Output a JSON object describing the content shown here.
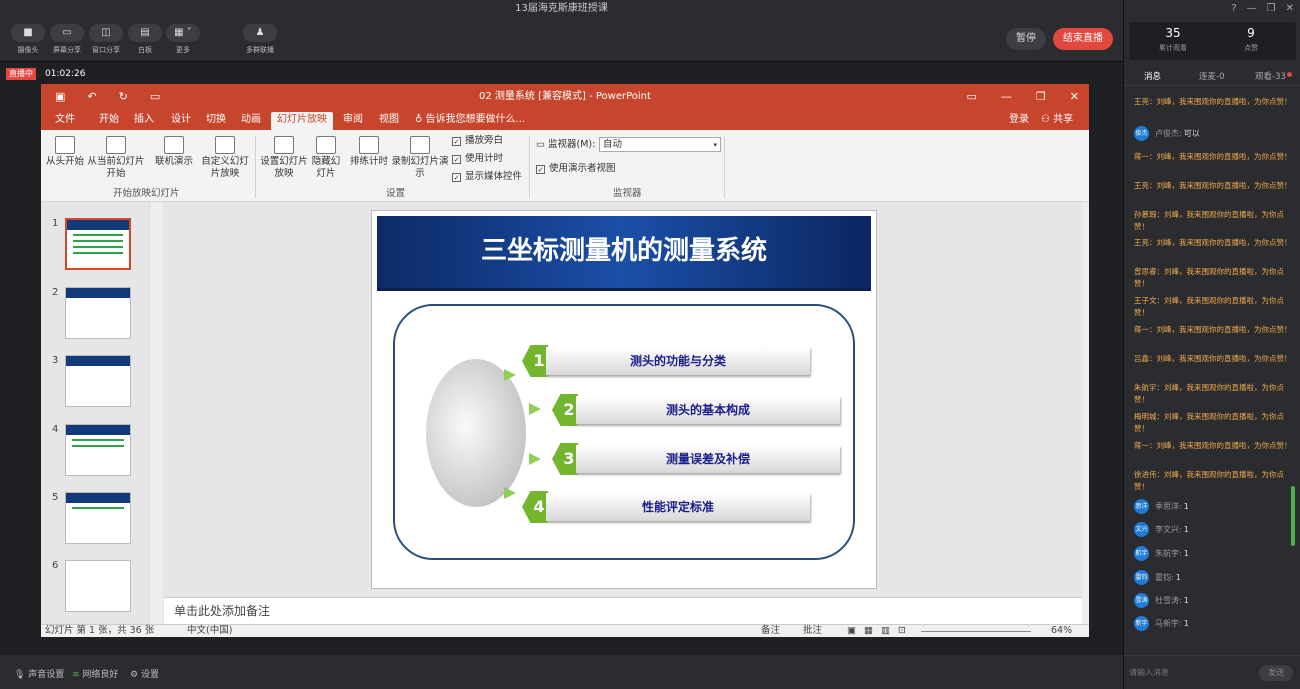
{
  "window": {
    "title": "13届海克斯康班授课"
  },
  "toolbar": {
    "buttons": [
      {
        "label": "摄像头",
        "icon": "camera-icon"
      },
      {
        "label": "屏幕分享",
        "icon": "screen-share-icon"
      },
      {
        "label": "窗口分享",
        "icon": "window-share-icon"
      },
      {
        "label": "白板",
        "icon": "whiteboard-icon"
      },
      {
        "label": "更多",
        "icon": "grid-icon"
      },
      {
        "label": "多群联播",
        "icon": "multi-group-icon"
      }
    ],
    "pause": "暂停",
    "end": "结束直播"
  },
  "live": {
    "status": "直播中",
    "time": "01:02:26"
  },
  "ppt": {
    "title": "02 测量系统 [兼容模式] - PowerPoint",
    "tabs": [
      "文件",
      "开始",
      "插入",
      "设计",
      "切换",
      "动画",
      "幻灯片放映",
      "审阅",
      "视图"
    ],
    "tell_me": "告诉我您想要做什么...",
    "login": "登录",
    "share": "共享",
    "ribbon": {
      "from_beginning": "从头开始",
      "from_current": "从当前幻灯片开始",
      "online": "联机演示",
      "custom": "自定义幻灯片放映",
      "group1": "开始放映幻灯片",
      "setup": "设置幻灯片放映",
      "hide": "隐藏幻灯片",
      "rehearse": "排练计时",
      "record": "录制幻灯片演示",
      "play_narration": "播放旁白",
      "use_timings": "使用计时",
      "show_media": "显示媒体控件",
      "group2": "设置",
      "monitor_label": "监视器(M):",
      "monitor_value": "自动",
      "presenter_view": "使用演示者视图",
      "group3": "监视器"
    },
    "thumb_numbers": [
      "1",
      "2",
      "3",
      "4",
      "5",
      "6"
    ],
    "slide": {
      "title": "三坐标测量机的测量系统",
      "items": [
        {
          "num": "1",
          "text": "测头的功能与分类"
        },
        {
          "num": "2",
          "text": "测头的基本构成"
        },
        {
          "num": "3",
          "text": "测量误差及补偿"
        },
        {
          "num": "4",
          "text": "性能评定标准"
        }
      ]
    },
    "notes": "单击此处添加备注",
    "status": {
      "slide": "幻灯片 第 1 张，共 36 张",
      "lang": "中文(中国)",
      "notes": "备注",
      "comments": "批注",
      "zoom": "64%"
    }
  },
  "bottom": {
    "sound": "声音设置",
    "network": "网络良好",
    "settings": "设置"
  },
  "sidebar": {
    "stats": [
      {
        "value": "35",
        "label": "累计观看"
      },
      {
        "value": "9",
        "label": "点赞"
      }
    ],
    "tabs": [
      "消息",
      "连麦-0",
      "观看-33"
    ],
    "messages": [
      {
        "text": "王亮：刘峰，我来围观你的直播啦，为你点赞！"
      },
      {
        "text": "蒋一：刘峰，我来围观你的直播啦，为你点赞！"
      },
      {
        "text": "王亮：刘峰，我来围观你的直播啦，为你点赞！"
      },
      {
        "text": "孙慕瑕：刘峰，我来围观你的直播啦，为你点赞！"
      },
      {
        "text": "王亮：刘峰，我来围观你的直播啦，为你点赞！"
      },
      {
        "text": "曾思睿：刘峰，我来围观你的直播啦，为你点赞！"
      },
      {
        "text": "王子文：刘峰，我来围观你的直播啦，为你点赞！"
      },
      {
        "text": "蒋一：刘峰，我来围观你的直播啦，为你点赞！"
      },
      {
        "text": "吕鑫：刘峰，我来围观你的直播啦，为你点赞！"
      },
      {
        "text": "朱航宇：刘峰，我来围观你的直播啦，为你点赞！"
      },
      {
        "text": "梅明城：刘峰，我来围观你的直播啦，为你点赞！"
      },
      {
        "text": "蒋一：刘峰，我来围观你的直播啦，为你点赞！"
      },
      {
        "text": "徐进伟：刘峰，我来围观你的直播啦，为你点赞！"
      }
    ],
    "chat_first": {
      "avatar": "俊杰",
      "name": "卢俊杰:",
      "text": "可以"
    },
    "rows": [
      {
        "avatar": "思洋",
        "name": "季思洋:",
        "text": "1"
      },
      {
        "avatar": "文兴",
        "name": "李文兴:",
        "text": "1"
      },
      {
        "avatar": "航宇",
        "name": "朱航宇:",
        "text": "1"
      },
      {
        "avatar": "雷钧",
        "name": "雷钧:",
        "text": "1"
      },
      {
        "avatar": "雪涛",
        "name": "杜雪涛:",
        "text": "1"
      },
      {
        "avatar": "新宇",
        "name": "马新宇:",
        "text": "1"
      }
    ],
    "input_placeholder": "请输入消息",
    "send": "发送"
  }
}
